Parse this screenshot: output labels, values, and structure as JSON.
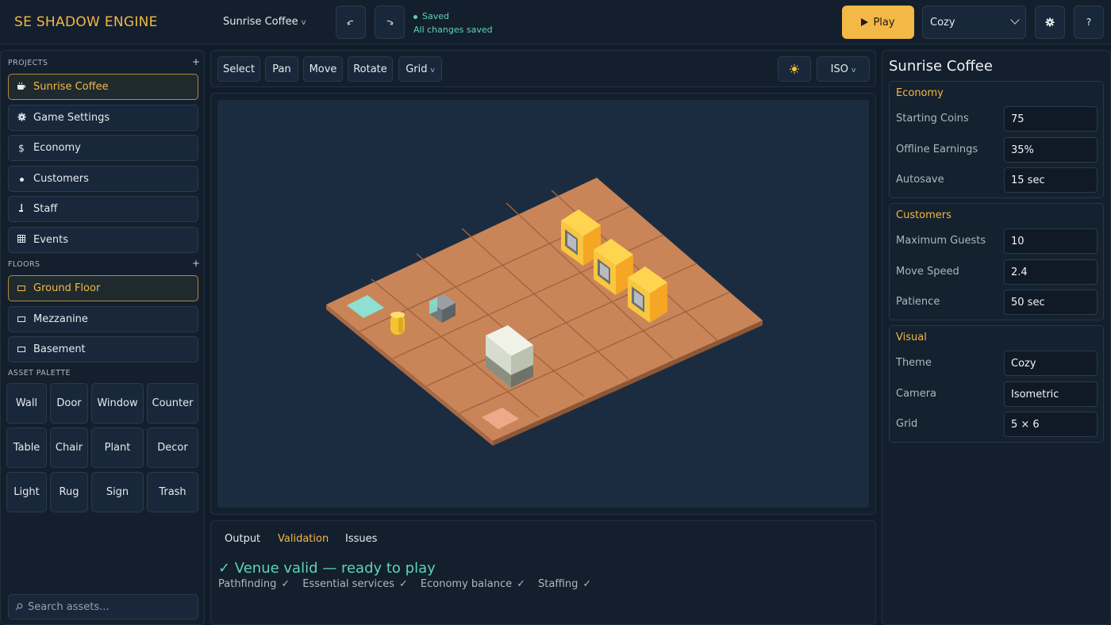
{
  "header": {
    "logo": "SE  SHADOW ENGINE",
    "project": "Sunrise Coffee",
    "project_chevron": "v",
    "undo_icon": "undo-icon",
    "redo_icon": "redo-icon",
    "status_title": "Saved",
    "status_sub": "All changes saved",
    "play_label": "Play",
    "theme_value": "Cozy",
    "settings_icon": "gear-icon",
    "help_label": "?"
  },
  "sidebar": {
    "projects_label": "PROJECTS",
    "projects_add": "+",
    "projects": [
      {
        "label": "Sunrise Coffee",
        "icon": "coffee-icon",
        "active": true
      },
      {
        "label": "Game Settings",
        "icon": "gear-icon",
        "active": false
      },
      {
        "label": "Economy",
        "icon": "dollar-icon",
        "active": false
      },
      {
        "label": "Customers",
        "icon": "dot-icon",
        "active": false
      },
      {
        "label": "Staff",
        "icon": "staff-icon",
        "active": false
      },
      {
        "label": "Events",
        "icon": "calendar-icon",
        "active": false
      }
    ],
    "floors_label": "FLOORS",
    "floors_add": "+",
    "floors": [
      {
        "label": "Ground Floor",
        "active": true
      },
      {
        "label": "Mezzanine",
        "active": false
      },
      {
        "label": "Basement",
        "active": false
      }
    ],
    "palette_label": "ASSET PALETTE",
    "assets": [
      "Wall",
      "Door",
      "Window",
      "Counter",
      "Table",
      "Chair",
      "Plant",
      "Decor",
      "Light",
      "Rug",
      "Sign",
      "Trash"
    ],
    "search_placeholder": "Search assets..."
  },
  "toolbar": {
    "tools": [
      "Select",
      "Pan",
      "Move",
      "Rotate",
      "Grid"
    ],
    "grid_chevron": "v",
    "light_icon": "sun-icon",
    "view_mode": "ISO",
    "view_chevron": "v"
  },
  "console": {
    "tabs": [
      "Output",
      "Validation",
      "Issues"
    ],
    "active_tab": "Validation",
    "valid_title": "✓  Venue valid — ready to play",
    "checks": [
      "Pathfinding",
      "Essential services",
      "Economy balance",
      "Staffing"
    ],
    "tick": "✓"
  },
  "inspector": {
    "title": "Sunrise Coffee",
    "groups": [
      {
        "title": "Economy",
        "props": [
          {
            "label": "Starting Coins",
            "value": "75"
          },
          {
            "label": "Offline Earnings",
            "value": "35%"
          },
          {
            "label": "Autosave",
            "value": "15 sec"
          }
        ]
      },
      {
        "title": "Customers",
        "props": [
          {
            "label": "Maximum Guests",
            "value": "10"
          },
          {
            "label": "Move Speed",
            "value": "2.4"
          },
          {
            "label": "Patience",
            "value": "50 sec"
          }
        ]
      },
      {
        "title": "Visual",
        "props": [
          {
            "label": "Theme",
            "value": "Cozy"
          },
          {
            "label": "Camera",
            "value": "Isometric"
          },
          {
            "label": "Grid",
            "value": "5 × 6"
          }
        ]
      }
    ]
  },
  "colors": {
    "accent": "#f4b846",
    "success": "#5fd3b9",
    "floor": "#c98558"
  }
}
